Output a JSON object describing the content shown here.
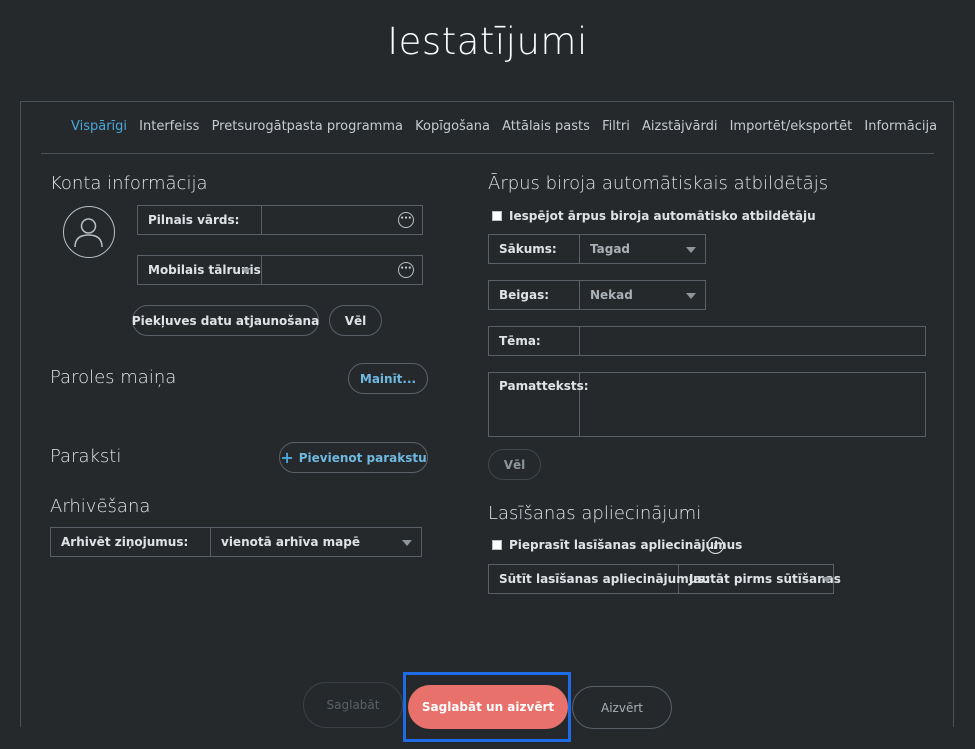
{
  "title": "Iestatījumi",
  "tabs": [
    "Vispārīgi",
    "Interfeiss",
    "Pretsurogātpasta programma",
    "Kopīgošana",
    "Attālais pasts",
    "Filtri",
    "Aizstājvārdi",
    "Importēt/eksportēt",
    "Informācija"
  ],
  "account": {
    "heading": "Konta informācija",
    "fullname_label": "Pilnais vārds:",
    "fullname_value": "",
    "phone_label": "Mobilais tālrunis",
    "phone_value": "",
    "refresh_label": "Piekļuves datu atjaunošana",
    "more_label": "Vēl"
  },
  "password": {
    "heading": "Paroles maiņa",
    "change_label": "Mainīt..."
  },
  "signatures": {
    "heading": "Paraksti",
    "add_label": "Pievienot parakstu"
  },
  "archive": {
    "heading": "Arhivēšana",
    "label": "Arhivēt ziņojumus:",
    "value": "vienotā arhīva mapē"
  },
  "autoreply": {
    "heading": "Ārpus biroja automātiskais atbildētājs",
    "enable_label": "Iespējot ārpus biroja automātisko atbildētāju",
    "start_label": "Sākums:",
    "start_value": "Tagad",
    "end_label": "Beigas:",
    "end_value": "Nekad",
    "subject_label": "Tēma:",
    "subject_value": "",
    "body_label": "Pamatteksts:",
    "body_value": "",
    "more_label": "Vēl"
  },
  "receipts": {
    "heading": "Lasīšanas apliecinājumi",
    "request_label": "Pieprasīt lasīšanas apliecinājumus",
    "send_label": "Sūtīt lasīšanas apliecinājumus:",
    "send_value": "Jautāt pirms sūtīšanas"
  },
  "footer": {
    "save": "Saglabāt",
    "save_close": "Saglabāt un aizvērt",
    "close": "Aizvērt"
  },
  "colors": {
    "accent": "#4aa8d8",
    "primary_button": "#e8716b",
    "highlight": "#1e6be6",
    "background": "#25292c"
  }
}
